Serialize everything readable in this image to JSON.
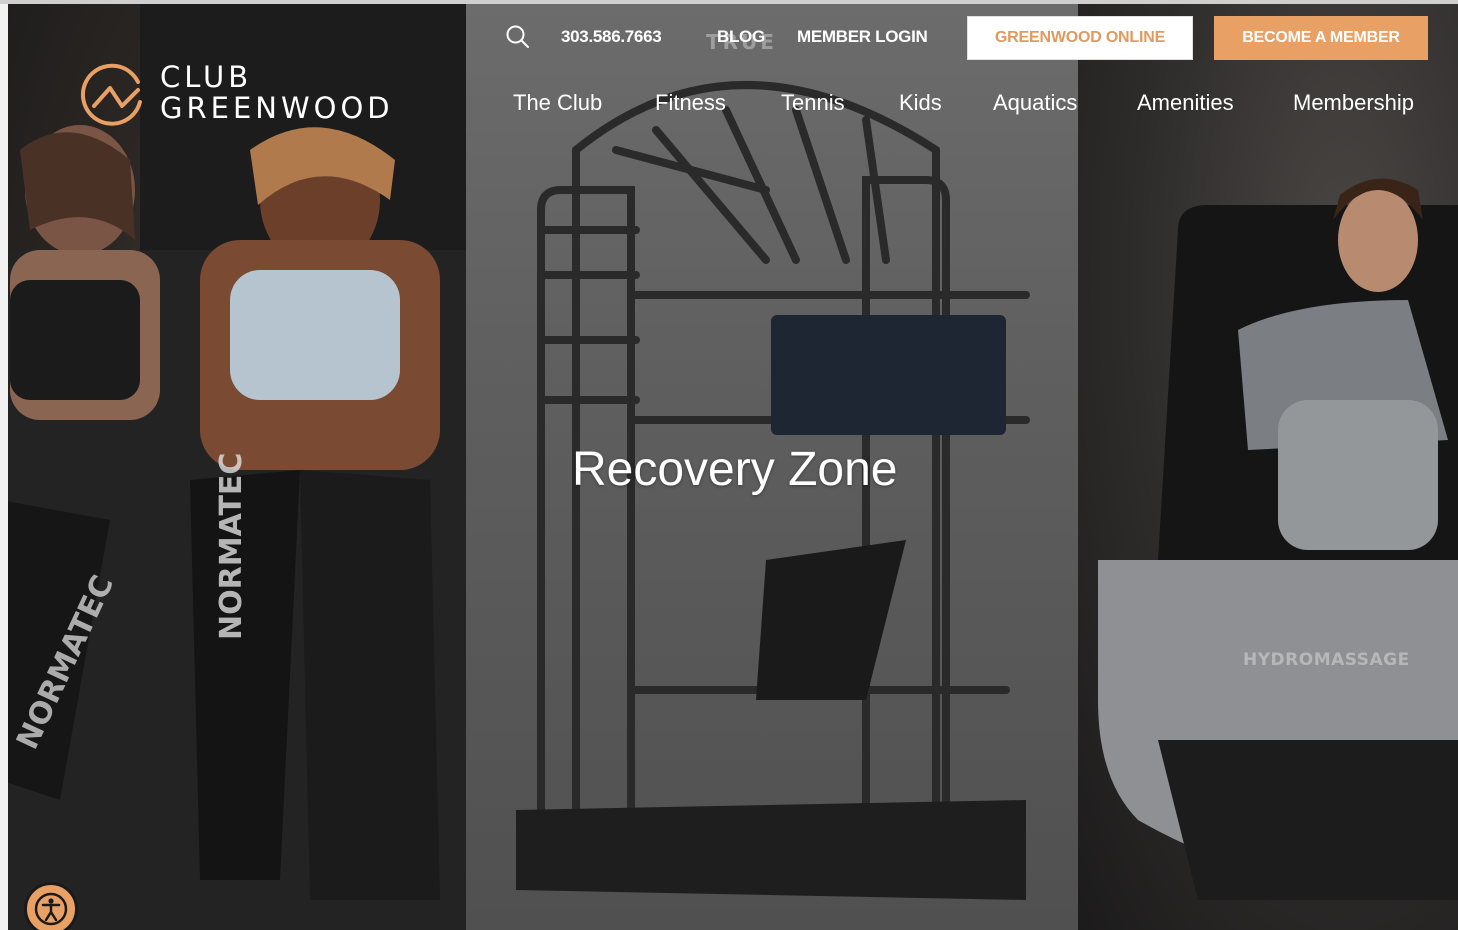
{
  "header": {
    "logo": {
      "line1": "CLUB",
      "line2": "GREENWOOD"
    },
    "utility": {
      "phone": "303.586.7663",
      "blog": "BLOG",
      "member_login": "MEMBER LOGIN"
    },
    "buttons": {
      "greenwood_online": "GREENWOOD ONLINE",
      "become_member": "BECOME A MEMBER"
    },
    "nav": [
      {
        "label": "The Club"
      },
      {
        "label": "Fitness"
      },
      {
        "label": "Tennis"
      },
      {
        "label": "Kids"
      },
      {
        "label": "Aquatics"
      },
      {
        "label": "Amenities"
      },
      {
        "label": "Membership"
      }
    ]
  },
  "hero": {
    "title": "Recovery Zone",
    "brand_marks": {
      "left": "NORMATEC",
      "middle": "TRUE",
      "right": "HYDROMASSAGE"
    }
  },
  "colors": {
    "accent": "#e8a064",
    "accent_text": "#e09a5f",
    "white": "#ffffff"
  },
  "icons": {
    "search": "search-icon",
    "logo": "club-greenwood-logo-icon",
    "accessibility": "accessibility-icon"
  }
}
